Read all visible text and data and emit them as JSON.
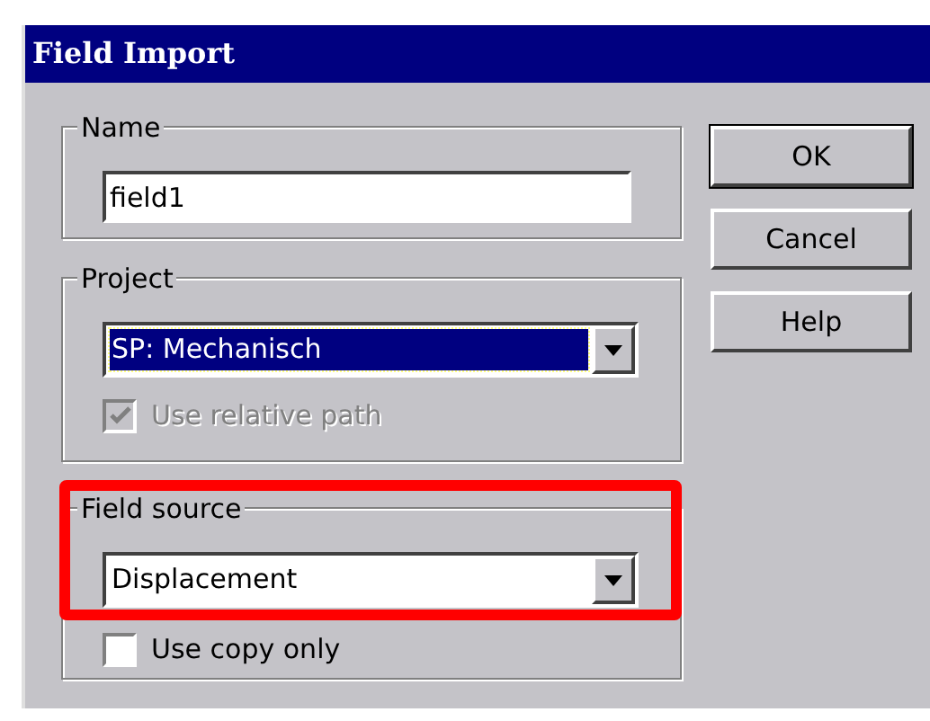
{
  "window": {
    "title": "Field Import"
  },
  "name_group": {
    "label": "Name",
    "value": "field1"
  },
  "project_group": {
    "label": "Project",
    "value": "SP: Mechanisch",
    "focused": true,
    "relative_path": {
      "label": "Use relative path",
      "checked": true,
      "disabled": true
    }
  },
  "field_source_group": {
    "label": "Field source",
    "value": "Displacement",
    "highlighted": true,
    "copy_only": {
      "label": "Use copy only",
      "checked": false,
      "disabled": false
    }
  },
  "buttons": [
    {
      "label": "OK",
      "default": true
    },
    {
      "label": "Cancel",
      "default": false
    },
    {
      "label": "Help",
      "default": false
    }
  ]
}
